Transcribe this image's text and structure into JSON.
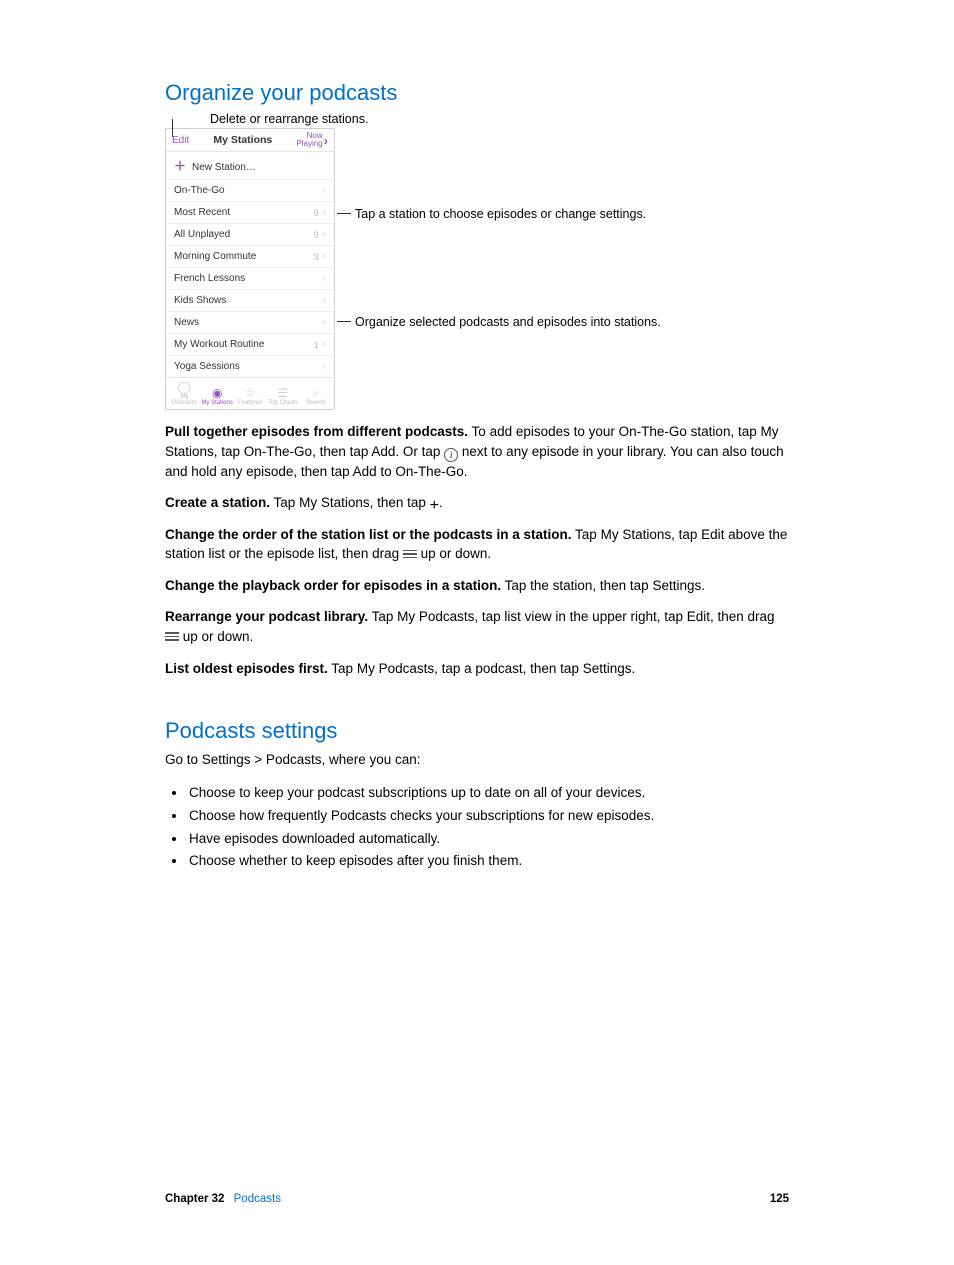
{
  "headings": {
    "h1": "Organize your podcasts",
    "h2": "Podcasts settings"
  },
  "callouts": {
    "top": "Delete or rearrange stations.",
    "side1": "Tap a station to choose episodes or change settings.",
    "side2": "Organize selected podcasts and episodes into stations."
  },
  "phone": {
    "edit": "Edit",
    "title": "My Stations",
    "now1": "Now",
    "now2": "Playing",
    "newStation": "New Station…",
    "rows": [
      {
        "label": "On-The-Go",
        "count": ""
      },
      {
        "label": "Most Recent",
        "count": "9"
      },
      {
        "label": "All Unplayed",
        "count": "9"
      },
      {
        "label": "Morning Commute",
        "count": "3"
      },
      {
        "label": "French Lessons",
        "count": ""
      },
      {
        "label": "Kids Shows",
        "count": ""
      },
      {
        "label": "News",
        "count": ""
      },
      {
        "label": "My Workout Routine",
        "count": "1"
      },
      {
        "label": "Yoga Sessions",
        "count": ""
      }
    ],
    "tabs": {
      "t1": "My Podcasts",
      "t2": "My Stations",
      "t3": "Featured",
      "t4": "Top Charts",
      "t5": "Search"
    }
  },
  "paragraphs": {
    "p1b": "Pull together episodes from different podcasts.",
    "p1a": " To add episodes to your On-The-Go station, tap My Stations, tap On-The-Go, then tap Add. Or tap ",
    "p1c": " next to any episode in your library. You can also touch and hold any episode, then tap Add to On-The-Go.",
    "p2b": "Create a station.",
    "p2a": " Tap My Stations, then tap ",
    "p2c": ".",
    "p3b": "Change the order of the station list or the podcasts in a station.",
    "p3a": " Tap My Stations, tap Edit above the station list or the episode list, then drag ",
    "p3c": " up or down.",
    "p4b": "Change the playback order for episodes in a station.",
    "p4a": " Tap the station, then tap Settings.",
    "p5b": "Rearrange your podcast library.",
    "p5a": " Tap My Podcasts, tap list view in the upper right, tap Edit, then drag ",
    "p5c": " up or down.",
    "p6b": "List oldest episodes first.",
    "p6a": " Tap My Podcasts, tap a podcast, then tap Settings.",
    "p7": "Go to Settings > Podcasts, where you can:"
  },
  "bullets": {
    "b1": "Choose to keep your podcast subscriptions up to date on all of your devices.",
    "b2": "Choose how frequently Podcasts checks your subscriptions for new episodes.",
    "b3": "Have episodes downloaded automatically.",
    "b4": "Choose whether to keep episodes after you finish them."
  },
  "footer": {
    "chapter": "Chapter  32",
    "section": "Podcasts",
    "page": "125"
  }
}
